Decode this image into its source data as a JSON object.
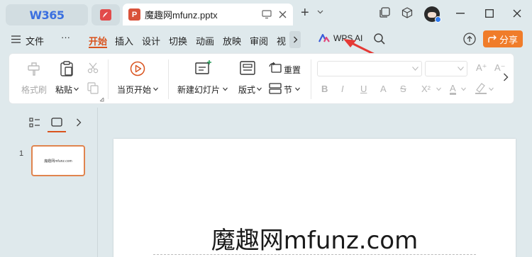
{
  "app": {
    "brand": "W365"
  },
  "tabs": {
    "pdf_badge": "PDF",
    "doc": {
      "badge": "P",
      "title": "魔趣网mfunz.pptx"
    }
  },
  "menu": {
    "file": "文件",
    "more": "···",
    "items": [
      "开始",
      "插入",
      "设计",
      "切换",
      "动画",
      "放映",
      "审阅",
      "视"
    ],
    "wps_ai": "WPS AI",
    "share": "分享"
  },
  "ribbon": {
    "format_painter": "格式刷",
    "paste": "粘贴",
    "start_from_current": "当页开始",
    "new_slide": "新建幻灯片",
    "layout": "版式",
    "reset": "重置",
    "section": "节"
  },
  "slides": {
    "current_index": "1",
    "thumb_text": "魔趣网mfunz.com",
    "title": "魔趣网mfunz.com"
  },
  "colors": {
    "accent": "#d9531e",
    "share_button": "#f07c2a",
    "ppt_badge": "#d9523a",
    "brand": "#3a6fe0"
  },
  "annotation": {
    "arrow_color": "#e53935"
  }
}
